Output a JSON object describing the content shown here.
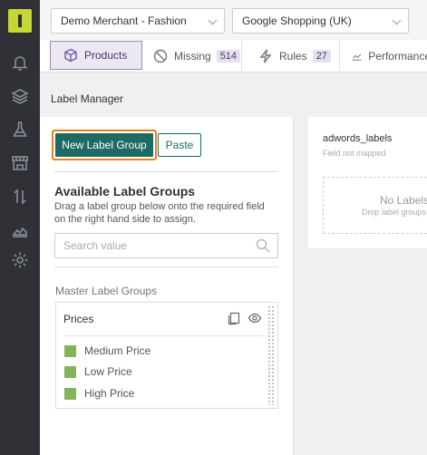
{
  "accent": "#1e6b65",
  "brand": "#c5d735",
  "sidebar": {
    "icons": [
      "bell-icon",
      "layers-icon",
      "flask-icon",
      "store-icon",
      "transfer-icon",
      "chart-icon",
      "gear-icon"
    ]
  },
  "header": {
    "merchant_select": "Demo Merchant - Fashion",
    "channel_select": "Google Shopping (UK)"
  },
  "tabs": [
    {
      "label": "Products",
      "icon": "cube-icon",
      "active": true
    },
    {
      "label": "Missing",
      "badge": "514",
      "icon": "ban-icon"
    },
    {
      "label": "Rules",
      "badge": "27",
      "icon": "bolt-icon"
    },
    {
      "label": "Performance",
      "icon": "line-chart-icon"
    }
  ],
  "page": {
    "title": "Label Manager"
  },
  "left_panel": {
    "new_button": "New Label Group",
    "paste_button": "Paste",
    "available_title": "Available Label Groups",
    "available_desc": "Drag a label group below onto the required field on the right hand side to assign.",
    "search_placeholder": "Search value",
    "master_label": "Master Label Groups",
    "group": {
      "name": "Prices",
      "labels": [
        "Medium Price",
        "Low Price",
        "High Price"
      ],
      "label_color": "#84b35a"
    }
  },
  "right_panel": {
    "field_name": "adwords_labels",
    "field_status": "Field not mapped",
    "drop_title": "No Labels a",
    "drop_sub": "Drop label groups"
  }
}
